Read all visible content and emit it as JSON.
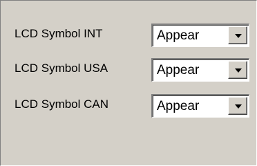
{
  "settings": {
    "rows": [
      {
        "label": "LCD Symbol INT",
        "value": "Appear"
      },
      {
        "label": "LCD Symbol USA",
        "value": "Appear"
      },
      {
        "label": "LCD Symbol CAN",
        "value": "Appear"
      }
    ]
  },
  "icons": {
    "dropdown": "chevron-down-icon"
  }
}
